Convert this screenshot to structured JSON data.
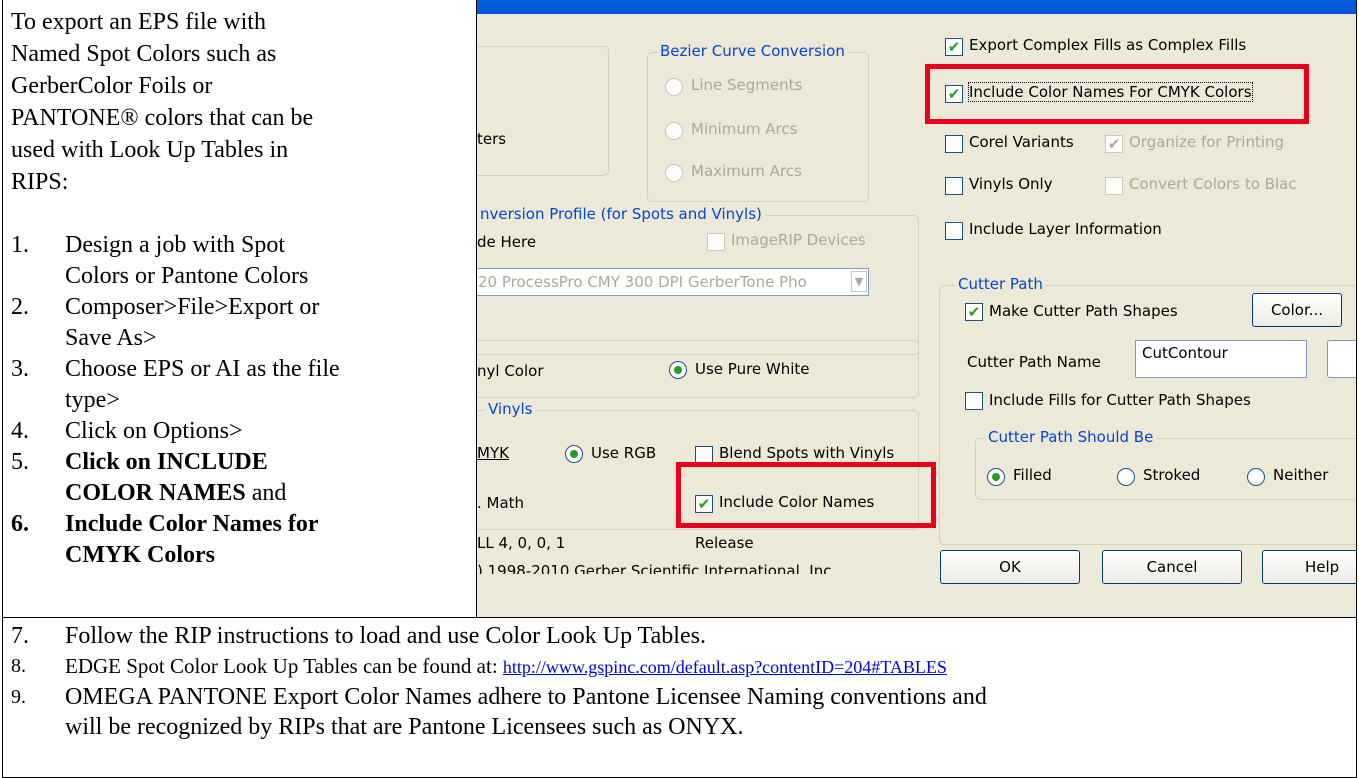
{
  "intro": {
    "line1": "To export an EPS file with",
    "line2": "Named Spot Colors such as",
    "line3": "GerberColor Foils or",
    "line4": "PANTONE® colors that can be",
    "line5": "used with Look Up Tables in",
    "line6": "RIPS:"
  },
  "steps": [
    {
      "num": "1.",
      "line1": "Design a job with Spot",
      "line2": "Colors or Pantone Colors"
    },
    {
      "num": "2.",
      "line1": "Composer>File>Export or",
      "line2": "Save As>"
    },
    {
      "num": "3.",
      "line1": "Choose EPS or AI as the file",
      "line2": "type>"
    },
    {
      "num": "4.",
      "line1": "Click on Options>"
    },
    {
      "num": "5.",
      "bold": "Click on INCLUDE",
      "bold2": "COLOR NAMES",
      "rest": " and"
    },
    {
      "num": "6.",
      "line1": "Include Color Names for",
      "line2": "CMYK Colors"
    }
  ],
  "bottom": {
    "s7": {
      "num": "7.",
      "text": "Follow the RIP instructions to load and use Color Look Up Tables."
    },
    "s8": {
      "num": "8.",
      "text": "EDGE Spot Color Look Up Tables can be found at: ",
      "link": "http://www.gspinc.com/default.asp?contentID=204#TABLES"
    },
    "s9": {
      "num": "9.",
      "line1": "OMEGA PANTONE Export Color Names adhere to Pantone Licensee Naming conventions and",
      "line2": "will be recognized by RIPs that are Pantone Licensees such as ONYX."
    }
  },
  "dialog": {
    "bezier": {
      "legend": "Bezier Curve Conversion",
      "line_segments": "Line Segments",
      "minimum_arcs": "Minimum Arcs",
      "maximum_arcs": "Maximum Arcs"
    },
    "left_fragment_ters": "ters",
    "export_complex": "Export Complex Fills as Complex Fills",
    "include_cmyk_names": "Include Color Names For CMYK Colors",
    "corel_variants": "Corel Variants",
    "organize_printing": "Organize for Printing",
    "vinyls_only": "Vinyls Only",
    "convert_black": "Convert Colors to Blac",
    "include_layer": "Include Layer Information",
    "profile": {
      "legend": "nversion Profile (for Spots and Vinyls)",
      "de_here": "de Here",
      "imagerip": "ImageRIP Devices",
      "select_value": "20 ProcessPro CMY 300 DPI GerberTone Pho"
    },
    "nyl_color": "nyl Color",
    "use_pure_white": "Use Pure White",
    "vinyls_legend": "Vinyls",
    "mykk": "MYK",
    "use_rgb": "Use RGB",
    "blend_spots": "Blend Spots with Vinyls",
    "math": ". Math",
    "include_color_names": "Include Color Names",
    "version": "LL 4, 0, 0, 1",
    "release": "Release",
    "copyright": ") 1998-2010 Gerber Scientific International, Inc.",
    "cutter": {
      "legend": "Cutter Path",
      "make_shapes": "Make Cutter Path Shapes",
      "color_button": "Color...",
      "name_label": "Cutter Path Name",
      "name_value": "CutContour",
      "include_fills": "Include Fills for Cutter Path Shapes",
      "should_be_legend": "Cutter Path Should Be",
      "filled": "Filled",
      "stroked": "Stroked",
      "neither": "Neither"
    },
    "ok": "OK",
    "cancel": "Cancel",
    "help": "Help"
  },
  "colors": {
    "highlight_red": "#e8001c",
    "dialog_bg": "#ece9d8",
    "legend_blue": "#0046d5"
  }
}
